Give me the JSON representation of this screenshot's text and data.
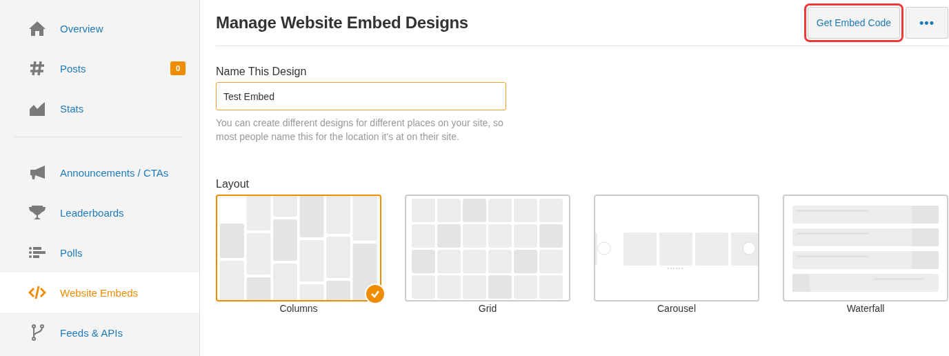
{
  "sidebar": {
    "groups": [
      {
        "items": [
          {
            "label": "Overview",
            "selected": false
          },
          {
            "label": "Posts",
            "selected": false,
            "badge": "0"
          },
          {
            "label": "Stats",
            "selected": false
          }
        ]
      },
      {
        "items": [
          {
            "label": "Announcements / CTAs",
            "selected": false
          },
          {
            "label": "Leaderboards",
            "selected": false
          },
          {
            "label": "Polls",
            "selected": false
          },
          {
            "label": "Website Embeds",
            "selected": true
          },
          {
            "label": "Feeds & APIs",
            "selected": false
          }
        ]
      }
    ]
  },
  "header": {
    "title": "Manage Website Embed Designs",
    "primary_button": {
      "label": "Get Embed Code",
      "highlighted": true
    },
    "more_button": {
      "label": "•••"
    }
  },
  "name_field": {
    "label": "Name This Design",
    "value": "Test Embed",
    "help": "You can create different designs for different places on your site, so most people name this for the location it's at on their site."
  },
  "layout": {
    "label": "Layout",
    "options": [
      {
        "kind": "columns",
        "label": "Columns",
        "selected": true
      },
      {
        "kind": "grid",
        "label": "Grid",
        "selected": false
      },
      {
        "kind": "carousel",
        "label": "Carousel",
        "selected": false
      },
      {
        "kind": "waterfall",
        "label": "Waterfall",
        "selected": false
      }
    ]
  }
}
